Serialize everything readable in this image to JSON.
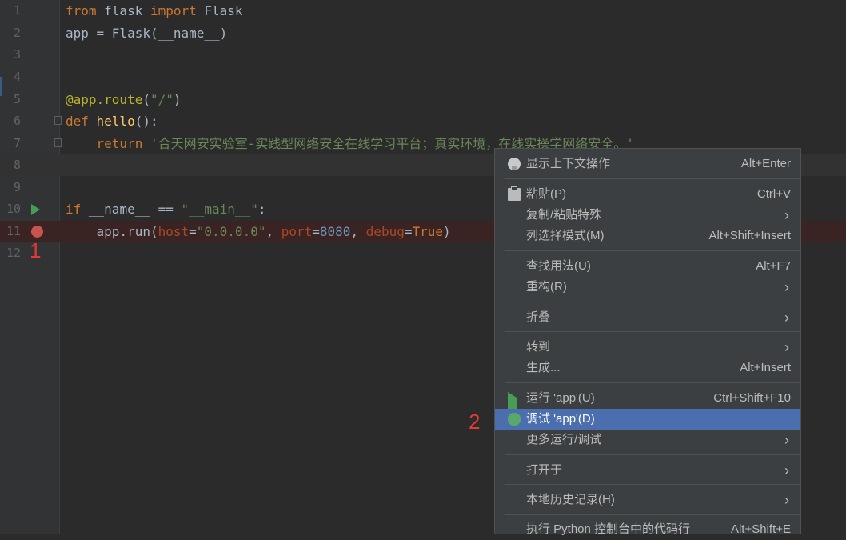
{
  "editor": {
    "lines": [
      {
        "num": "1",
        "tokens": [
          [
            "kw",
            "from"
          ],
          [
            "plain",
            " flask "
          ],
          [
            "kw",
            "import"
          ],
          [
            "plain",
            " Flask"
          ]
        ]
      },
      {
        "num": "2",
        "tokens": [
          [
            "plain",
            "app = Flask(__name__)"
          ]
        ]
      },
      {
        "num": "3",
        "tokens": []
      },
      {
        "num": "4",
        "tokens": []
      },
      {
        "num": "5",
        "tokens": [
          [
            "dec",
            "@app.route"
          ],
          [
            "plain",
            "("
          ],
          [
            "str",
            "\"/\""
          ],
          [
            "plain",
            ")"
          ]
        ]
      },
      {
        "num": "6",
        "tokens": [
          [
            "kw",
            "def "
          ],
          [
            "fn",
            "hello"
          ],
          [
            "plain",
            "():"
          ]
        ]
      },
      {
        "num": "7",
        "tokens": [
          [
            "plain",
            "    "
          ],
          [
            "kw",
            "return "
          ],
          [
            "str",
            "'合天网安实验室-实践型网络安全在线学习平台；真实环境，在线实操学网络安全。'"
          ]
        ]
      },
      {
        "num": "8",
        "tokens": []
      },
      {
        "num": "9",
        "tokens": []
      },
      {
        "num": "10",
        "tokens": [
          [
            "kw",
            "if "
          ],
          [
            "plain",
            "__name__ == "
          ],
          [
            "str",
            "\"__main__\""
          ],
          [
            "plain",
            ":"
          ]
        ]
      },
      {
        "num": "11",
        "tokens": [
          [
            "plain",
            "    app.run("
          ],
          [
            "param",
            "host"
          ],
          [
            "plain",
            "="
          ],
          [
            "str",
            "\"0.0.0.0\""
          ],
          [
            "plain",
            ", "
          ],
          [
            "param",
            "port"
          ],
          [
            "plain",
            "="
          ],
          [
            "num",
            "8080"
          ],
          [
            "plain",
            ", "
          ],
          [
            "param",
            "debug"
          ],
          [
            "plain",
            "="
          ],
          [
            "bool",
            "True"
          ],
          [
            "plain",
            ")"
          ]
        ]
      },
      {
        "num": "12",
        "tokens": []
      }
    ],
    "markers": {
      "one": "1",
      "two": "2"
    }
  },
  "context_menu": {
    "items": [
      {
        "label": "显示上下文操作",
        "shortcut": "Alt+Enter",
        "icon": "lightbulb-icon"
      },
      {
        "label": "粘贴(P)",
        "shortcut": "Ctrl+V",
        "icon": "clipboard-icon"
      },
      {
        "label": "复制/粘贴特殊",
        "submenu": true
      },
      {
        "label": "列选择模式(M)",
        "shortcut": "Alt+Shift+Insert"
      },
      {
        "label": "查找用法(U)",
        "shortcut": "Alt+F7"
      },
      {
        "label": "重构(R)",
        "submenu": true
      },
      {
        "label": "折叠",
        "submenu": true
      },
      {
        "label": "转到",
        "submenu": true
      },
      {
        "label": "生成...",
        "shortcut": "Alt+Insert"
      },
      {
        "label": "运行 'app'(U)",
        "shortcut": "Ctrl+Shift+F10",
        "icon": "run-icon"
      },
      {
        "label": "调试 'app'(D)",
        "icon": "debug-icon",
        "selected": true
      },
      {
        "label": "更多运行/调试",
        "submenu": true
      },
      {
        "label": "打开于",
        "submenu": true
      },
      {
        "label": "本地历史记录(H)",
        "submenu": true
      },
      {
        "label": "执行 Python 控制台中的代码行",
        "shortcut": "Alt+Shift+E"
      }
    ],
    "submenu_arrow": "›"
  },
  "colors": {
    "background": "#2b2b2b",
    "selection": "#4b6eaf",
    "breakpoint": "#c75450",
    "run_green": "#499c54"
  }
}
